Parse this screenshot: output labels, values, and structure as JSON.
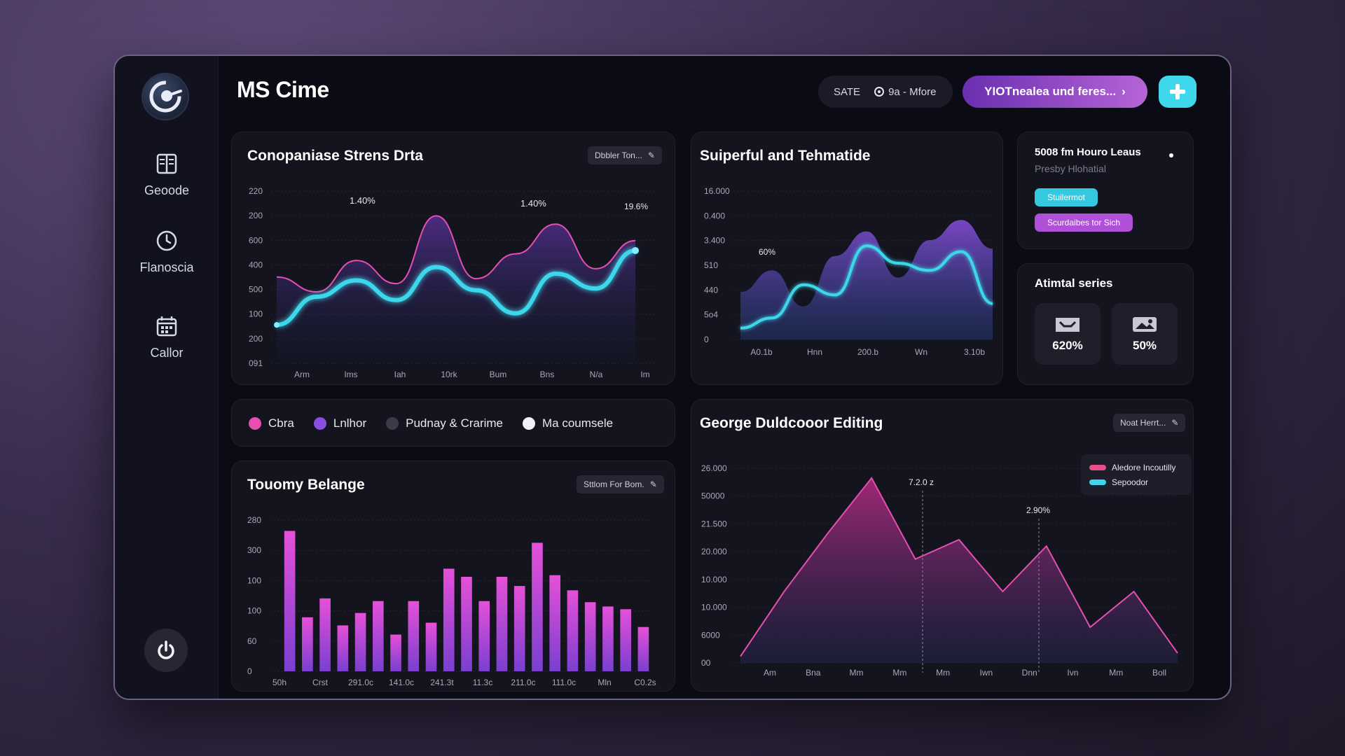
{
  "app": {
    "title": "MS Cime"
  },
  "sidebar": {
    "items": [
      {
        "label": "Geoode",
        "icon": "book-icon"
      },
      {
        "label": "Flanoscia",
        "icon": "clock-icon"
      },
      {
        "label": "Callor",
        "icon": "calendar-icon"
      }
    ],
    "bottom_icon": "power-icon"
  },
  "header": {
    "pill_left": "SATE",
    "pill_right": "9a - Mfore",
    "primary_button": "YIOTnealea und feres...",
    "plus_icon": "plus-icon"
  },
  "colors": {
    "accent_cyan": "#3ed7ec",
    "accent_purple": "#9b4fd0",
    "accent_pink": "#e64fb0",
    "background": "#0b0b16"
  },
  "card1": {
    "title": "Conopaniase Strens Drta",
    "button": "Dbbler Ton...",
    "annotations": [
      "1.40%",
      "1.40%",
      "19.6%"
    ],
    "chart_data": {
      "type": "line",
      "title": "Conopaniase Strens Drta",
      "categories": [
        "Arm",
        "Ims",
        "Iah",
        "10rk",
        "Bum",
        "Bns",
        "N/a",
        "Im"
      ],
      "y_tick_labels": [
        "220",
        "200",
        "600",
        "400",
        "500",
        "100",
        "200",
        "091"
      ],
      "series": [
        {
          "color": "#3ed7ec",
          "values": [
            19,
            36,
            46,
            34,
            54,
            40,
            26,
            50,
            41,
            64
          ]
        },
        {
          "color": "#e64fb0",
          "values": [
            48,
            39,
            58,
            44,
            85,
            47,
            62,
            80,
            53,
            70
          ]
        }
      ]
    }
  },
  "card2": {
    "title": "Suiperful and Tehmatide",
    "annotation": "60%",
    "chart_data": {
      "type": "area",
      "title": "Suiperful and Tehmatide",
      "categories": [
        "A0.1b",
        "Hnn",
        "200.b",
        "Wn",
        "3.10b"
      ],
      "y_tick_labels": [
        "16.000",
        "0.400",
        "3.400",
        "510",
        "440",
        "5o4",
        "0"
      ],
      "series": [
        {
          "color": "#3ed7ec",
          "values": [
            5,
            12,
            35,
            28,
            62,
            50,
            45,
            58,
            22
          ]
        },
        {
          "color": "#9b4fd0",
          "values": [
            30,
            45,
            20,
            55,
            72,
            40,
            66,
            80,
            60
          ]
        }
      ]
    }
  },
  "card3": {
    "title": "5008 fm Houro Leaus",
    "subtitle": "Presby Hlohatial",
    "button_cyan": "Stuilermot",
    "button_purple": "Scurdaibes tor Sich"
  },
  "card4": {
    "title": "Atimtal series",
    "stats": [
      {
        "icon": "inbox-icon",
        "value": "620%"
      },
      {
        "icon": "image-icon",
        "value": "50%"
      }
    ]
  },
  "legend": {
    "items": [
      {
        "label": "Cbra",
        "color": "#e64fb0"
      },
      {
        "label": "Lnlhor",
        "color": "#8a4fe0"
      },
      {
        "label": "Pudnay & Crarime",
        "color": "#3a3a48"
      },
      {
        "label": "Ma coumsele",
        "color": "#f2f2f6"
      }
    ]
  },
  "card5": {
    "title": "Touomy Belange",
    "button": "Sttlom For Bom.",
    "chart_data": {
      "type": "bar",
      "title": "Touomy Belange",
      "x_tick_labels": [
        "50h",
        "Crst",
        "291.0c",
        "141.0c",
        "241.3t",
        "11.3c",
        "211.0c",
        "111.0c",
        "Mln",
        "C0.2s"
      ],
      "y_tick_labels": [
        "280",
        "300",
        "100",
        "100",
        "60",
        "0"
      ],
      "values": [
        260,
        100,
        135,
        85,
        108,
        130,
        68,
        130,
        90,
        190,
        175,
        130,
        175,
        158,
        238,
        178,
        150,
        128,
        120,
        115,
        82
      ]
    }
  },
  "card6": {
    "title": "George Duldcooor Editing",
    "button": "Noat Herrt...",
    "annotations": [
      "7.2.0 z",
      "2.90%"
    ],
    "legend": [
      "Aledore Incoutilly",
      "Sepoodor"
    ],
    "chart_data": {
      "type": "area",
      "title": "George Duldcooor Editing",
      "categories": [
        "Am",
        "Bna",
        "Mm",
        "Mm",
        "Mm",
        "Iwn",
        "Dnn",
        "Ivn",
        "Mm",
        "Boll"
      ],
      "y_tick_labels": [
        "26.000",
        "50000",
        "21.500",
        "20.000",
        "10.000",
        "10.000",
        "6000",
        "00"
      ],
      "series": [
        {
          "name": "Aledore Incoutilly",
          "color": "#e64fb0",
          "values": [
            2,
            22,
            40,
            57,
            32,
            38,
            22,
            36,
            11,
            22,
            3
          ]
        },
        {
          "name": "Sepoodor",
          "color": "#3ed7ec",
          "values": []
        }
      ]
    }
  }
}
